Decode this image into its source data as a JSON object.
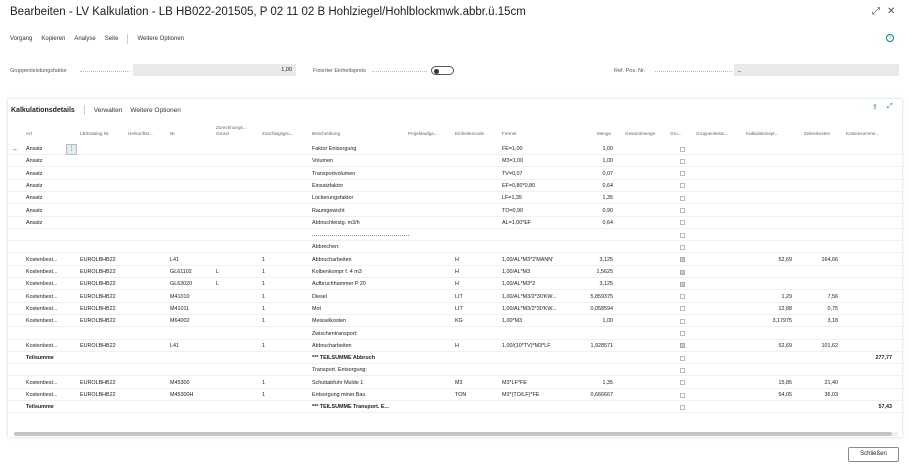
{
  "window": {
    "title": "Bearbeiten - LV Kalkulation - LB HB022-201505, P 02 11 02 B Hohlziegel/Hohlblockmwk.abbr.ü.15cm",
    "expand_glyph": "⤢",
    "close_glyph": "✕"
  },
  "menu": [
    "Vorgang",
    "Kopieren",
    "Analyse",
    "Seite"
  ],
  "menu_more": "Weitere Optionen",
  "info_icon": "i",
  "fields": {
    "grp_label": "Gruppenleistungsfaktor",
    "grp_value": "1,00",
    "fixed_label": "Fixierter Einheitspreis",
    "ref_label": "Ref. Pos. Nr.",
    "ref_value": "_"
  },
  "section": {
    "title": "Kalkulationsdetails",
    "manage": "Verwalten",
    "more": "Weitere Optionen",
    "icon1": "⇪",
    "icon2": "⤢"
  },
  "columns": {
    "art": "Art",
    "lb": "LB/Katalog Nr.",
    "herkunft": "Herkunftst...",
    "nr": "Nr.",
    "zurechnung1": "Zurechnungs...",
    "zurechnung2": "Grund",
    "zuschlag": "Zuschlagsgru...",
    "beschreibung": "Beschreibung",
    "projekt": "Projektaufga...",
    "einheit": "Einheitencode",
    "formel": "Formel",
    "menge": "Menge",
    "gesamt": "Gesamtmenge",
    "gru": "Gru...",
    "gruppen": "Gruppenleistu...",
    "kalkpreis": "Kalkulationspr...",
    "zeilen": "Zeilenkosten",
    "kosten": "Kostensumme..."
  },
  "rows": [
    {
      "art": "Ansatz",
      "lb": "",
      "nr": "",
      "z": "",
      "zg": "",
      "desc": "Faktor Entsorgung",
      "unit": "",
      "formel": "FE=1,00",
      "menge": "1,00",
      "cb": false,
      "kp": "",
      "zk": "",
      "ks": "",
      "bold": false
    },
    {
      "art": "Ansatz",
      "lb": "",
      "nr": "",
      "z": "",
      "zg": "",
      "desc": "Volumen",
      "unit": "",
      "formel": "M3=1,00",
      "menge": "1,00",
      "cb": false,
      "kp": "",
      "zk": "",
      "ks": "",
      "bold": false
    },
    {
      "art": "Ansatz",
      "lb": "",
      "nr": "",
      "z": "",
      "zg": "",
      "desc": "Transportvolumen",
      "unit": "",
      "formel": "TV=0,07",
      "menge": "0,07",
      "cb": false,
      "kp": "",
      "zk": "",
      "ks": "",
      "bold": false
    },
    {
      "art": "Ansatz",
      "lb": "",
      "nr": "",
      "z": "",
      "zg": "",
      "desc": "Einsatzfaktor",
      "unit": "",
      "formel": "EF=0,80*0,80",
      "menge": "0,64",
      "cb": false,
      "kp": "",
      "zk": "",
      "ks": "",
      "bold": false
    },
    {
      "art": "Ansatz",
      "lb": "",
      "nr": "",
      "z": "",
      "zg": "",
      "desc": "Lockerungsfaktor",
      "unit": "",
      "formel": "LF=1,35",
      "menge": "1,35",
      "cb": false,
      "kp": "",
      "zk": "",
      "ks": "",
      "bold": false
    },
    {
      "art": "Ansatz",
      "lb": "",
      "nr": "",
      "z": "",
      "zg": "",
      "desc": "Raumgewicht",
      "unit": "",
      "formel": "TO=0,90",
      "menge": "0,90",
      "cb": false,
      "kp": "",
      "zk": "",
      "ks": "",
      "bold": false
    },
    {
      "art": "Ansatz",
      "lb": "",
      "nr": "",
      "z": "",
      "zg": "",
      "desc": "Abbruchleistg. m3/h",
      "unit": "",
      "formel": "AL=1,00*EF",
      "menge": "0,64",
      "cb": false,
      "kp": "",
      "zk": "",
      "ks": "",
      "bold": false
    },
    {
      "art": "",
      "lb": "",
      "nr": "",
      "z": "",
      "zg": "",
      "desc": "",
      "unit": "",
      "formel": "",
      "menge": "",
      "cb": false,
      "kp": "",
      "zk": "",
      "ks": "",
      "bold": false
    },
    {
      "art": "",
      "lb": "",
      "nr": "",
      "z": "",
      "zg": "",
      "desc": "Abbrechen:",
      "unit": "",
      "formel": "",
      "menge": "",
      "cb": false,
      "kp": "",
      "zk": "",
      "ks": "",
      "bold": false
    },
    {
      "art": "Kostenbest...",
      "lb": "EUROLBHB22",
      "nr": "L41",
      "z": "",
      "zg": "1",
      "desc": "Abbrucharbeiten",
      "unit": "H",
      "formel": "1,00/AL*M3*2'MANN'",
      "menge": "3,125",
      "cb": true,
      "kp": "52,69",
      "zk": "164,66",
      "ks": "",
      "bold": false
    },
    {
      "art": "Kostenbest...",
      "lb": "EUROLBHB22",
      "nr": "GL61102",
      "z": "L",
      "zg": "1",
      "desc": "Kolbenkompr f. 4 m3",
      "unit": "H",
      "formel": "1,00/AL*M3",
      "menge": "1,5625",
      "cb": true,
      "kp": "",
      "zk": "",
      "ks": "",
      "bold": false
    },
    {
      "art": "Kostenbest...",
      "lb": "EUROLBHB22",
      "nr": "GL63020",
      "z": "L",
      "zg": "1",
      "desc": "Aufbruchhammer P 20",
      "unit": "H",
      "formel": "1,00/AL*M3*2",
      "menge": "3,125",
      "cb": true,
      "kp": "",
      "zk": "",
      "ks": "",
      "bold": false
    },
    {
      "art": "Kostenbest...",
      "lb": "EUROLBHB22",
      "nr": "M41010",
      "z": "",
      "zg": "1",
      "desc": "Diesel",
      "unit": "LIT",
      "formel": "1,00/AL*M3/2*30'KW...",
      "menge": "5,859375",
      "cb": false,
      "kp": "1,29",
      "zk": "7,56",
      "ks": "",
      "bold": false
    },
    {
      "art": "Kostenbest...",
      "lb": "EUROLBHB22",
      "nr": "M41011",
      "z": "",
      "zg": "1",
      "desc": "Mot",
      "unit": "LIT",
      "formel": "1,00/AL*M3/2*30'KW...",
      "menge": "0,058594",
      "cb": false,
      "kp": "12,88",
      "zk": "0,75",
      "ks": "",
      "bold": false
    },
    {
      "art": "Kostenbest...",
      "lb": "EUROLBHB22",
      "nr": "M64002",
      "z": "",
      "zg": "1",
      "desc": "Meisselkosten",
      "unit": "KG",
      "formel": "1,00*M3",
      "menge": "1,00",
      "cb": false,
      "kp": "3,17975",
      "zk": "3,18",
      "ks": "",
      "bold": false
    },
    {
      "art": "",
      "lb": "",
      "nr": "",
      "z": "",
      "zg": "",
      "desc": "Zwischentransport:",
      "unit": "",
      "formel": "",
      "menge": "",
      "cb": false,
      "kp": "",
      "zk": "",
      "ks": "",
      "bold": false
    },
    {
      "art": "Kostenbest...",
      "lb": "EUROLBHB22",
      "nr": "L41",
      "z": "",
      "zg": "1",
      "desc": "Abbrucharbeiten",
      "unit": "H",
      "formel": "1,00/(10*TV)*M3*LF",
      "menge": "1,928571",
      "cb": true,
      "kp": "52,69",
      "zk": "101,62",
      "ks": "",
      "bold": false
    },
    {
      "art": "Teilsumme",
      "lb": "",
      "nr": "",
      "z": "",
      "zg": "",
      "desc": "*** TEILSUMME Abbruch",
      "unit": "",
      "formel": "",
      "menge": "",
      "cb": false,
      "kp": "",
      "zk": "",
      "ks": "277,77",
      "bold": true
    },
    {
      "art": "",
      "lb": "",
      "nr": "",
      "z": "",
      "zg": "",
      "desc": "Transport. Entsorgung:",
      "unit": "",
      "formel": "",
      "menge": "",
      "cb": false,
      "kp": "",
      "zk": "",
      "ks": "",
      "bold": false
    },
    {
      "art": "Kostenbest...",
      "lb": "EUROLBHB22",
      "nr": "M45300",
      "z": "",
      "zg": "1",
      "desc": "Schuttabfuhr Mulde 1",
      "unit": "M3",
      "formel": "M3*LF*FE",
      "menge": "1,35",
      "cb": false,
      "kp": "15,85",
      "zk": "21,40",
      "ks": "",
      "bold": false
    },
    {
      "art": "Kostenbest...",
      "lb": "EUROLBHB22",
      "nr": "M45300H",
      "z": "",
      "zg": "1",
      "desc": "Entsorgung miner.Bau",
      "unit": "TON",
      "formel": "M3*(TO/LF)*FE",
      "menge": "0,666667",
      "cb": false,
      "kp": "54,05",
      "zk": "36,03",
      "ks": "",
      "bold": false
    },
    {
      "art": "Teilsumme",
      "lb": "",
      "nr": "",
      "z": "",
      "zg": "",
      "desc": "*** TEILSUMME Transport. E...",
      "unit": "",
      "formel": "",
      "menge": "",
      "cb": false,
      "kp": "",
      "zk": "",
      "ks": "57,43",
      "bold": true
    }
  ],
  "row_arrow": "→",
  "row_menu": "⋮",
  "close_button": "Schließen"
}
